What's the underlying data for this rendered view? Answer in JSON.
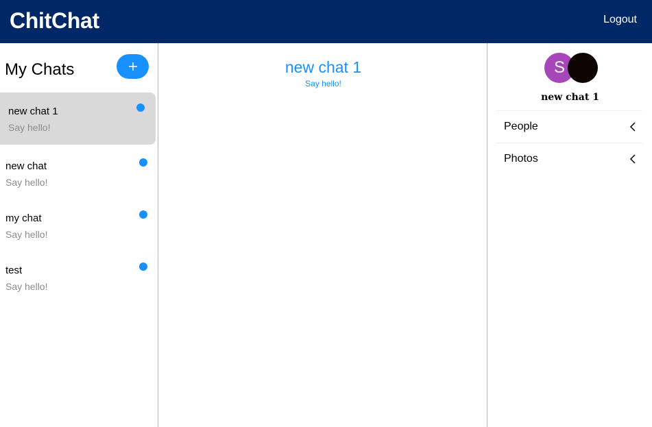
{
  "header": {
    "brand": "ChitChat",
    "logout_label": "Logout"
  },
  "chat_list": {
    "title": "My Chats",
    "new_button_icon": "plus-icon",
    "chats": [
      {
        "title": "new chat 1",
        "subtitle": "Say hello!",
        "active": true,
        "unread": true
      },
      {
        "title": "new chat",
        "subtitle": "Say hello!",
        "active": false,
        "unread": true
      },
      {
        "title": "my chat",
        "subtitle": "Say hello!",
        "active": false,
        "unread": true
      },
      {
        "title": "test",
        "subtitle": "Say hello!",
        "active": false,
        "unread": true
      }
    ]
  },
  "chat_feed": {
    "title": "new chat 1",
    "subtitle": "Say hello!"
  },
  "chat_settings": {
    "avatars": [
      {
        "initial": "S",
        "color": "#a646b8"
      },
      {
        "initial": "",
        "color": "#0e0303"
      }
    ],
    "title": "new chat 1",
    "sections": [
      {
        "label": "People",
        "icon": "chevron-left-icon"
      },
      {
        "label": "Photos",
        "icon": "chevron-left-icon"
      }
    ]
  },
  "colors": {
    "header_bg": "#002766",
    "accent": "#1890ff",
    "active_card": "#d9d9d9",
    "muted_text": "#8c8c8c"
  }
}
